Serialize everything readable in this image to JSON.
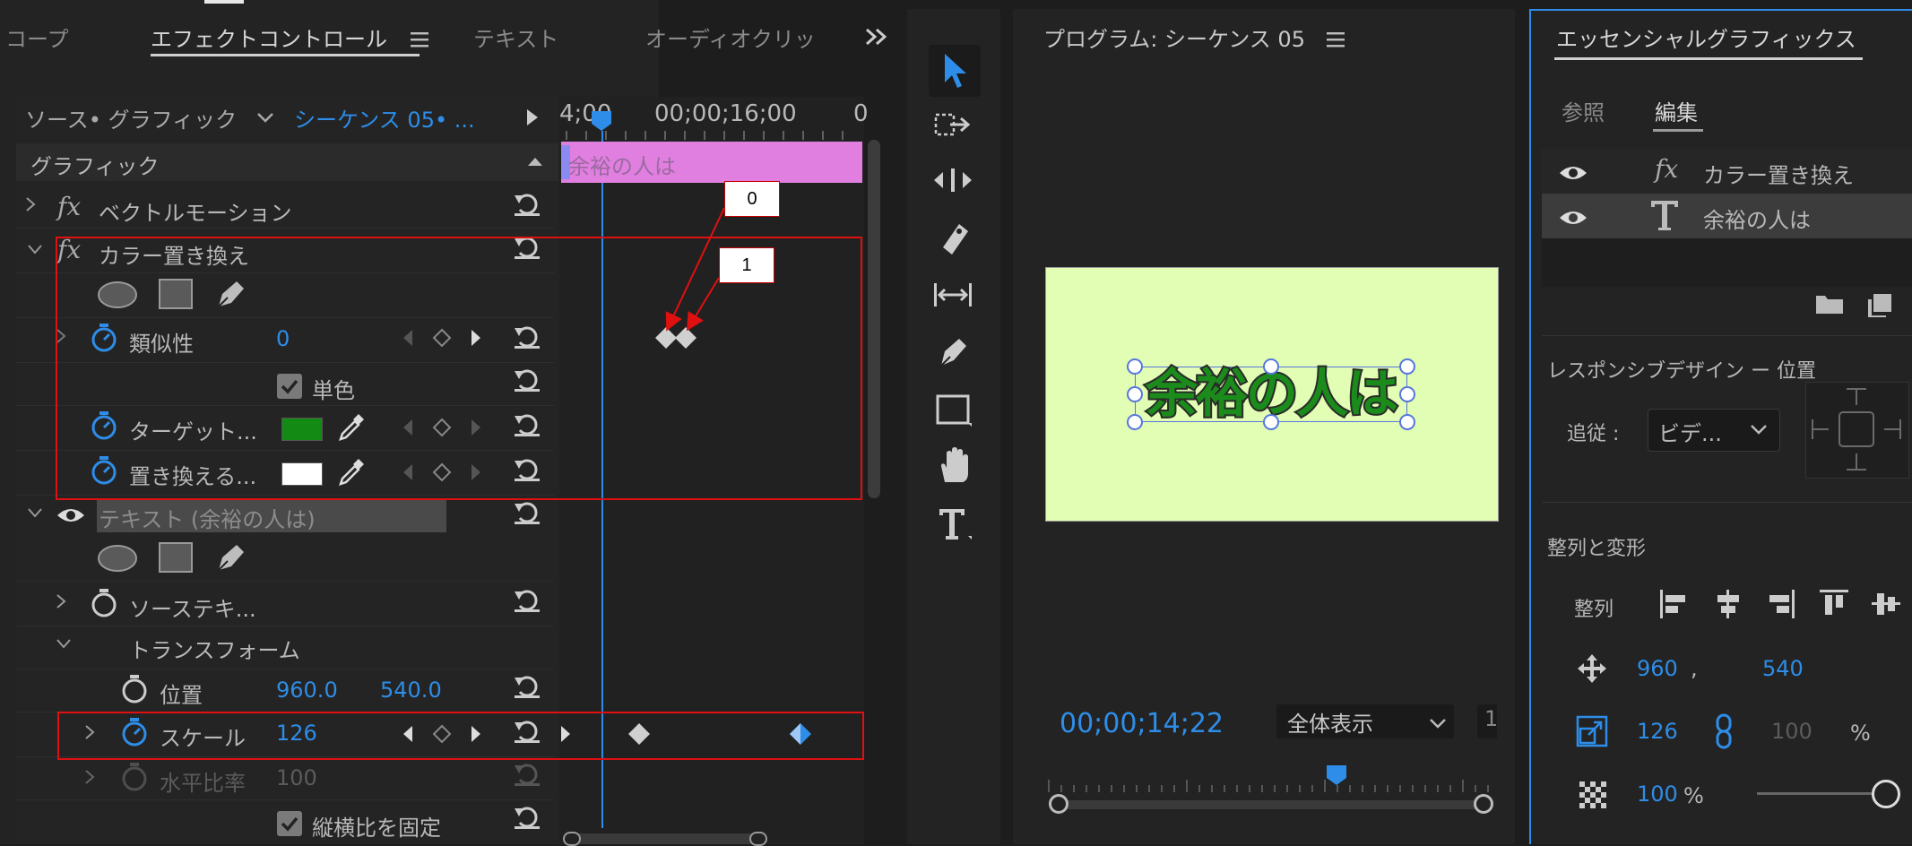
{
  "left_panel": {
    "tabs": [
      "コープ",
      "エフェクトコントロール",
      "テキスト",
      "オーディオクリッ"
    ],
    "active_tab_index": 1,
    "source_label": "ソース• グラフィック",
    "sequence_label": "シーケンス 05• ...",
    "timeline_time_left": "4;00",
    "timeline_time_mid": "00;00;16;00",
    "timeline_time_right": "0",
    "clip_label": "余裕の人は",
    "section_graphic": "グラフィック",
    "vector_motion": "ベクトルモーション",
    "color_replace": "カラー置き換え",
    "similarity_label": "類似性",
    "similarity_value": "0",
    "solid_color_label": "単色",
    "target_label": "ターゲット...",
    "target_color": "#138a13",
    "replace_label": "置き換える...",
    "replace_color": "#ffffff",
    "text_layer": "テキスト (余裕の人は)",
    "source_text": "ソーステキ...",
    "transform": "トランスフォーム",
    "position_label": "位置",
    "position_x": "960.0",
    "position_y": "540.0",
    "scale_label": "スケール",
    "scale_value": "126",
    "h_ratio_label": "水平比率",
    "h_ratio_value": "100",
    "lock_ratio_label": "縦横比を固定"
  },
  "callouts": [
    "0",
    "1"
  ],
  "program": {
    "title": "プログラム: シーケンス 05",
    "timecode": "00;00;14;22",
    "fit_label": "全体表示",
    "fit_right_fragment": "1",
    "preview_text": "余裕の人は",
    "preview_bg": "#e2fdb4",
    "preview_text_color": "#1b8b1b",
    "scrub_position": 0.67
  },
  "essential_graphics": {
    "title": "エッセンシャルグラフィックス",
    "tab_browse": "参照",
    "tab_edit": "編集",
    "layer_1": "カラー置き換え",
    "layer_2": "余裕の人は",
    "responsive_label": "レスポンシブデザイン ー 位置",
    "follow_label": "追従 :",
    "follow_value": "ビデ...",
    "align_title": "整列と変形",
    "align_label": "整列",
    "pos_x": "960",
    "pos_comma": ",",
    "pos_y": "540",
    "scale_value": "126",
    "scale_locked_value": "100",
    "percent": "%",
    "opacity_value": "100",
    "opacity_percent": "%",
    "opacity_level": 1.0
  },
  "colors": {
    "accent_blue": "#2e8de8",
    "clip_pink": "#e07fe0",
    "highlight_red": "#e01010"
  }
}
